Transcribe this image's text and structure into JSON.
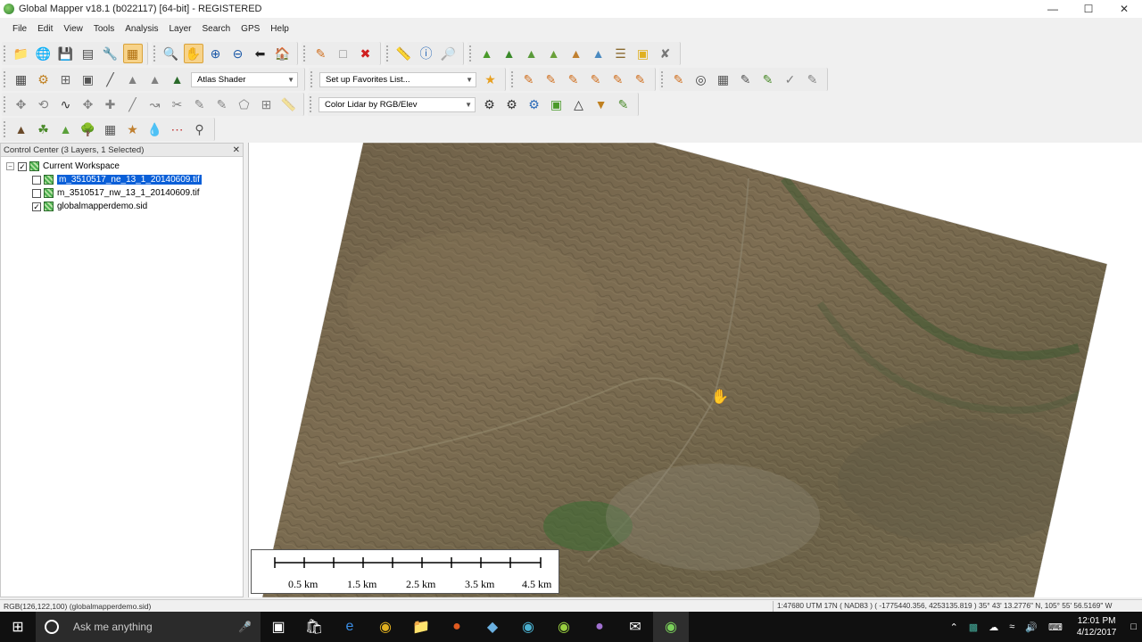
{
  "window": {
    "title": "Global Mapper v18.1 (b022117) [64-bit] - REGISTERED"
  },
  "menu": [
    "File",
    "Edit",
    "View",
    "Tools",
    "Analysis",
    "Layer",
    "Search",
    "GPS",
    "Help"
  ],
  "toolbar": {
    "shader_combo": "Atlas Shader",
    "favorites_combo": "Set up Favorites List...",
    "lidar_combo": "Color Lidar by RGB/Elev"
  },
  "control_center": {
    "title": "Control Center (3 Layers, 1 Selected)",
    "workspace": "Current Workspace",
    "layers": [
      {
        "name": "m_3510517_ne_13_1_20140609.tif",
        "checked": false,
        "selected": true
      },
      {
        "name": "m_3510517_nw_13_1_20140609.tif",
        "checked": false,
        "selected": false
      },
      {
        "name": "globalmapperdemo.sid",
        "checked": true,
        "selected": false
      }
    ]
  },
  "scalebar": {
    "labels": [
      "0.5 km",
      "1.5 km",
      "2.5 km",
      "3.5 km",
      "4.5 km"
    ]
  },
  "status": {
    "left": "RGB(126,122,100) (globalmapperdemo.sid)",
    "right": "1:47680  UTM 17N ( NAD83 ) ( -1775440.356, 4253135.819 )  35° 43' 13.2776\" N, 105° 55' 56.5169\" W"
  },
  "taskbar": {
    "search_placeholder": "Ask me anything",
    "time": "12:01 PM",
    "date": "4/12/2017"
  },
  "colors": {
    "selection": "#0a5fd8",
    "taskbar": "#101010"
  }
}
